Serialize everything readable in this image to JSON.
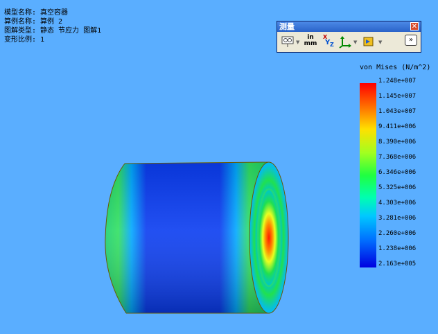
{
  "info": [
    {
      "key": "模型名称:",
      "value": "真空容器"
    },
    {
      "key": "算例名称:",
      "value": "算例 2"
    },
    {
      "key": "图解类型:",
      "value": "静态 节应力 图解1"
    },
    {
      "key": "变形比例:",
      "value": "1"
    }
  ],
  "measure_panel": {
    "title": "测量",
    "close_label": "✕",
    "units_label_top": "in",
    "units_label_bottom": "mm",
    "xyz_x": "X",
    "xyz_y": "Y",
    "xyz_z": "Z",
    "expand_label": "»"
  },
  "legend": {
    "title": "von Mises (N/m^2)",
    "labels": [
      "1.248e+007",
      "1.145e+007",
      "1.043e+007",
      "9.411e+006",
      "8.390e+006",
      "7.368e+006",
      "6.346e+006",
      "5.325e+006",
      "4.303e+006",
      "3.281e+006",
      "2.260e+006",
      "1.238e+006",
      "2.163e+005"
    ]
  }
}
